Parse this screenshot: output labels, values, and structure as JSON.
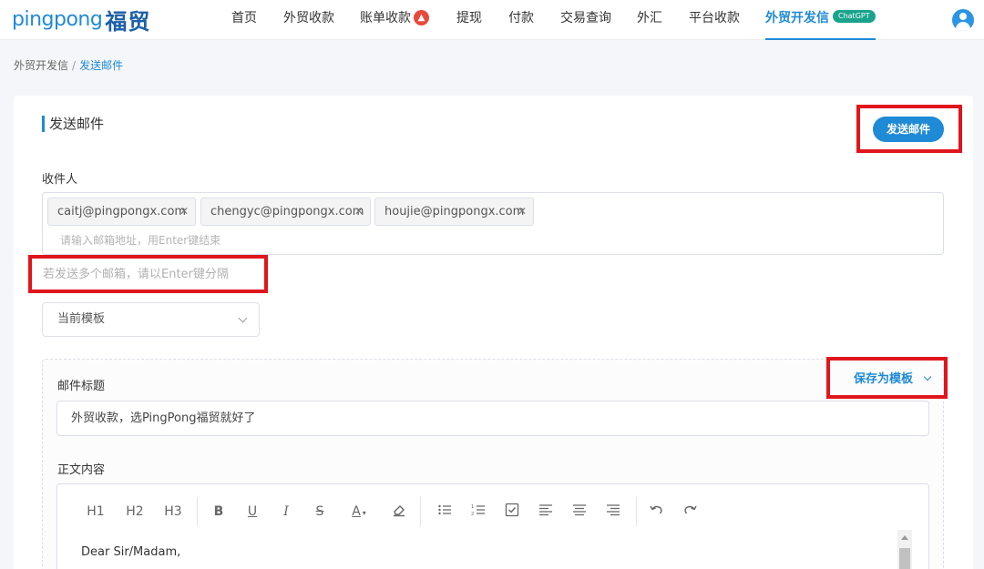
{
  "header": {
    "logo_latin": "pingpong",
    "logo_cn": "福贸",
    "nav": [
      {
        "label": "首页"
      },
      {
        "label": "外贸收款"
      },
      {
        "label": "账单收款",
        "badge": "fire-icon"
      },
      {
        "label": "提现"
      },
      {
        "label": "付款"
      },
      {
        "label": "交易查询"
      },
      {
        "label": "外汇"
      },
      {
        "label": "平台收款"
      },
      {
        "label": "外贸开发信",
        "badge": "ChatGPT",
        "active": true
      }
    ],
    "avatar_icon": "user-avatar-icon"
  },
  "breadcrumb": {
    "parent": "外贸开发信",
    "separator": "/",
    "current": "发送邮件"
  },
  "page": {
    "title": "发送邮件",
    "send_button": "发送邮件",
    "recipients_label": "收件人",
    "recipients": [
      "caitj@pingpongx.com",
      "chengyc@pingpongx.com",
      "houjie@pingpongx.com"
    ],
    "recipient_placeholder": "请输入邮箱地址，用Enter键结束",
    "hint": "若发送多个邮箱，请以Enter键分隔",
    "template_select": "当前模板",
    "subject_label": "邮件标题",
    "save_template": "保存为模板",
    "subject_value": "外贸收款，选PingPong福贸就好了",
    "body_label": "正文内容",
    "body_text": "Dear Sir/Madam,"
  },
  "toolbar": {
    "h1": "H1",
    "h2": "H2",
    "h3": "H3",
    "bold": "B",
    "underline": "U",
    "italic": "I",
    "strike": "S",
    "font_color": "A",
    "icons": [
      "eraser-icon",
      "bullet-list-icon",
      "numbered-list-icon",
      "checklist-icon",
      "align-left-icon",
      "align-center-icon",
      "align-right-icon",
      "undo-icon",
      "redo-icon"
    ]
  },
  "colors": {
    "accent": "#1f8ad6",
    "highlight": "#e0161c",
    "chatgpt_badge": "#19a38c"
  }
}
